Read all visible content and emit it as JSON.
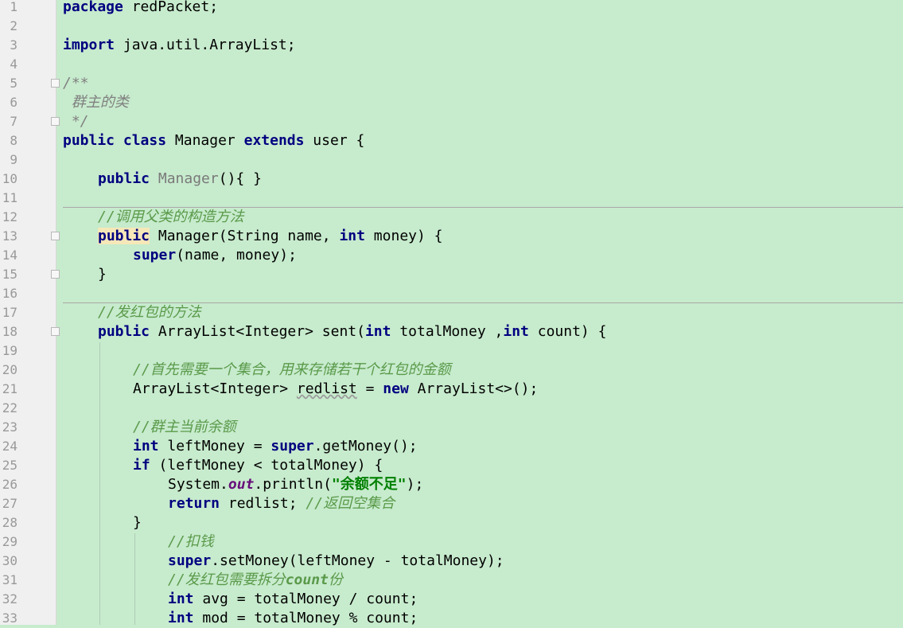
{
  "editor": {
    "line_numbers": [
      "1",
      "2",
      "3",
      "4",
      "5",
      "6",
      "7",
      "8",
      "9",
      "10",
      "11",
      "12",
      "13",
      "14",
      "15",
      "16",
      "17",
      "18",
      "19",
      "20",
      "21",
      "22",
      "23",
      "24",
      "25",
      "26",
      "27",
      "28",
      "29",
      "30",
      "31",
      "32",
      "33"
    ],
    "l1_kw": "package",
    "l1_rest": " redPacket;",
    "l3_kw": "import",
    "l3_rest": " java.util.ArrayList;",
    "l5": "/**",
    "l6": " 群主的类",
    "l7": " */",
    "l8_k1": "public",
    "l8_k2": "class",
    "l8_mid": " Manager ",
    "l8_k3": "extends",
    "l8_rest": " user {",
    "l10_kw": "public",
    "l10_name": "Manager",
    "l10_rest": "(){ }",
    "l12": "//调用父类的构造方法",
    "l13_kw": "public",
    "l13_a": " Manager(String name, ",
    "l13_kw2": "int",
    "l13_b": " money) {",
    "l14_kw": "super",
    "l14_rest": "(name, money);",
    "l15": "}",
    "l17": "//发红包的方法",
    "l18_kw": "public",
    "l18_a": " ArrayList<Integer> sent(",
    "l18_kw2": "int",
    "l18_b": " totalMoney ,",
    "l18_kw3": "int",
    "l18_c": " count) {",
    "l20": "//首先需要一个集合，用来存储若干个红包的金额",
    "l21_a": "ArrayList<Integer> ",
    "l21_var": "redlist",
    "l21_b": " = ",
    "l21_kw": "new",
    "l21_c": " ArrayList<>();",
    "l23": "//群主当前余额",
    "l24_kw": "int",
    "l24_a": " leftMoney = ",
    "l24_kw2": "super",
    "l24_b": ".getMoney();",
    "l25_kw": "if",
    "l25_rest": " (leftMoney < totalMoney) {",
    "l26_a": "System.",
    "l26_fld": "out",
    "l26_b": ".println(",
    "l26_str": "\"余额不足\"",
    "l26_c": ");",
    "l27_kw": "return",
    "l27_a": " redlist; ",
    "l27_cm": "//返回空集合",
    "l28": "}",
    "l29": "//扣钱",
    "l30_kw": "super",
    "l30_rest": ".setMoney(leftMoney - totalMoney);",
    "l31_a": "//发红包需要拆分",
    "l31_b": "count",
    "l31_c": "份",
    "l32_kw": "int",
    "l32_rest": " avg = totalMoney / count;",
    "l33_kw": "int",
    "l33_rest": " mod = totalMoney % count;"
  },
  "colors": {
    "background": "#c7ebcd",
    "keyword": "#000080",
    "comment": "#808080",
    "string": "#008000",
    "field": "#660e7a"
  }
}
